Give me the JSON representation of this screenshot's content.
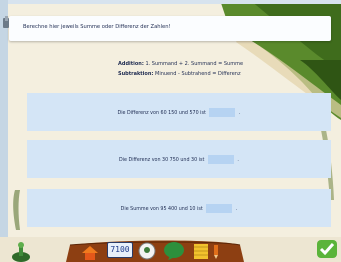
{
  "instruction": "Berechne hier jeweils Summe oder Differenz der Zahlen!",
  "legend": {
    "addition_term": "Addition:",
    "addition_rule": "1. Summand + 2. Summand = Summe",
    "subtraction_term": "Subtraktion:",
    "subtraction_rule": "Minuend - Subtrahend = Differenz"
  },
  "tasks": [
    {
      "prefix": "Die Differenz von 60 150 und 570 ist",
      "answer": "",
      "suffix": "."
    },
    {
      "prefix": "Die Differenz von 30 750 und 30 ist",
      "answer": "",
      "suffix": "."
    },
    {
      "prefix": "Die Summe von 95 400 und 10 ist",
      "answer": "",
      "suffix": "."
    }
  ],
  "toolbar": {
    "numbers_button_label": "7100"
  },
  "colors": {
    "card_bg": "#d4e5f6",
    "input_bg": "#b6d3f2",
    "tree_green": "#3f6c1c",
    "ground_beige": "#f1e8cf",
    "toolbar_brown": "#8d3f12"
  }
}
